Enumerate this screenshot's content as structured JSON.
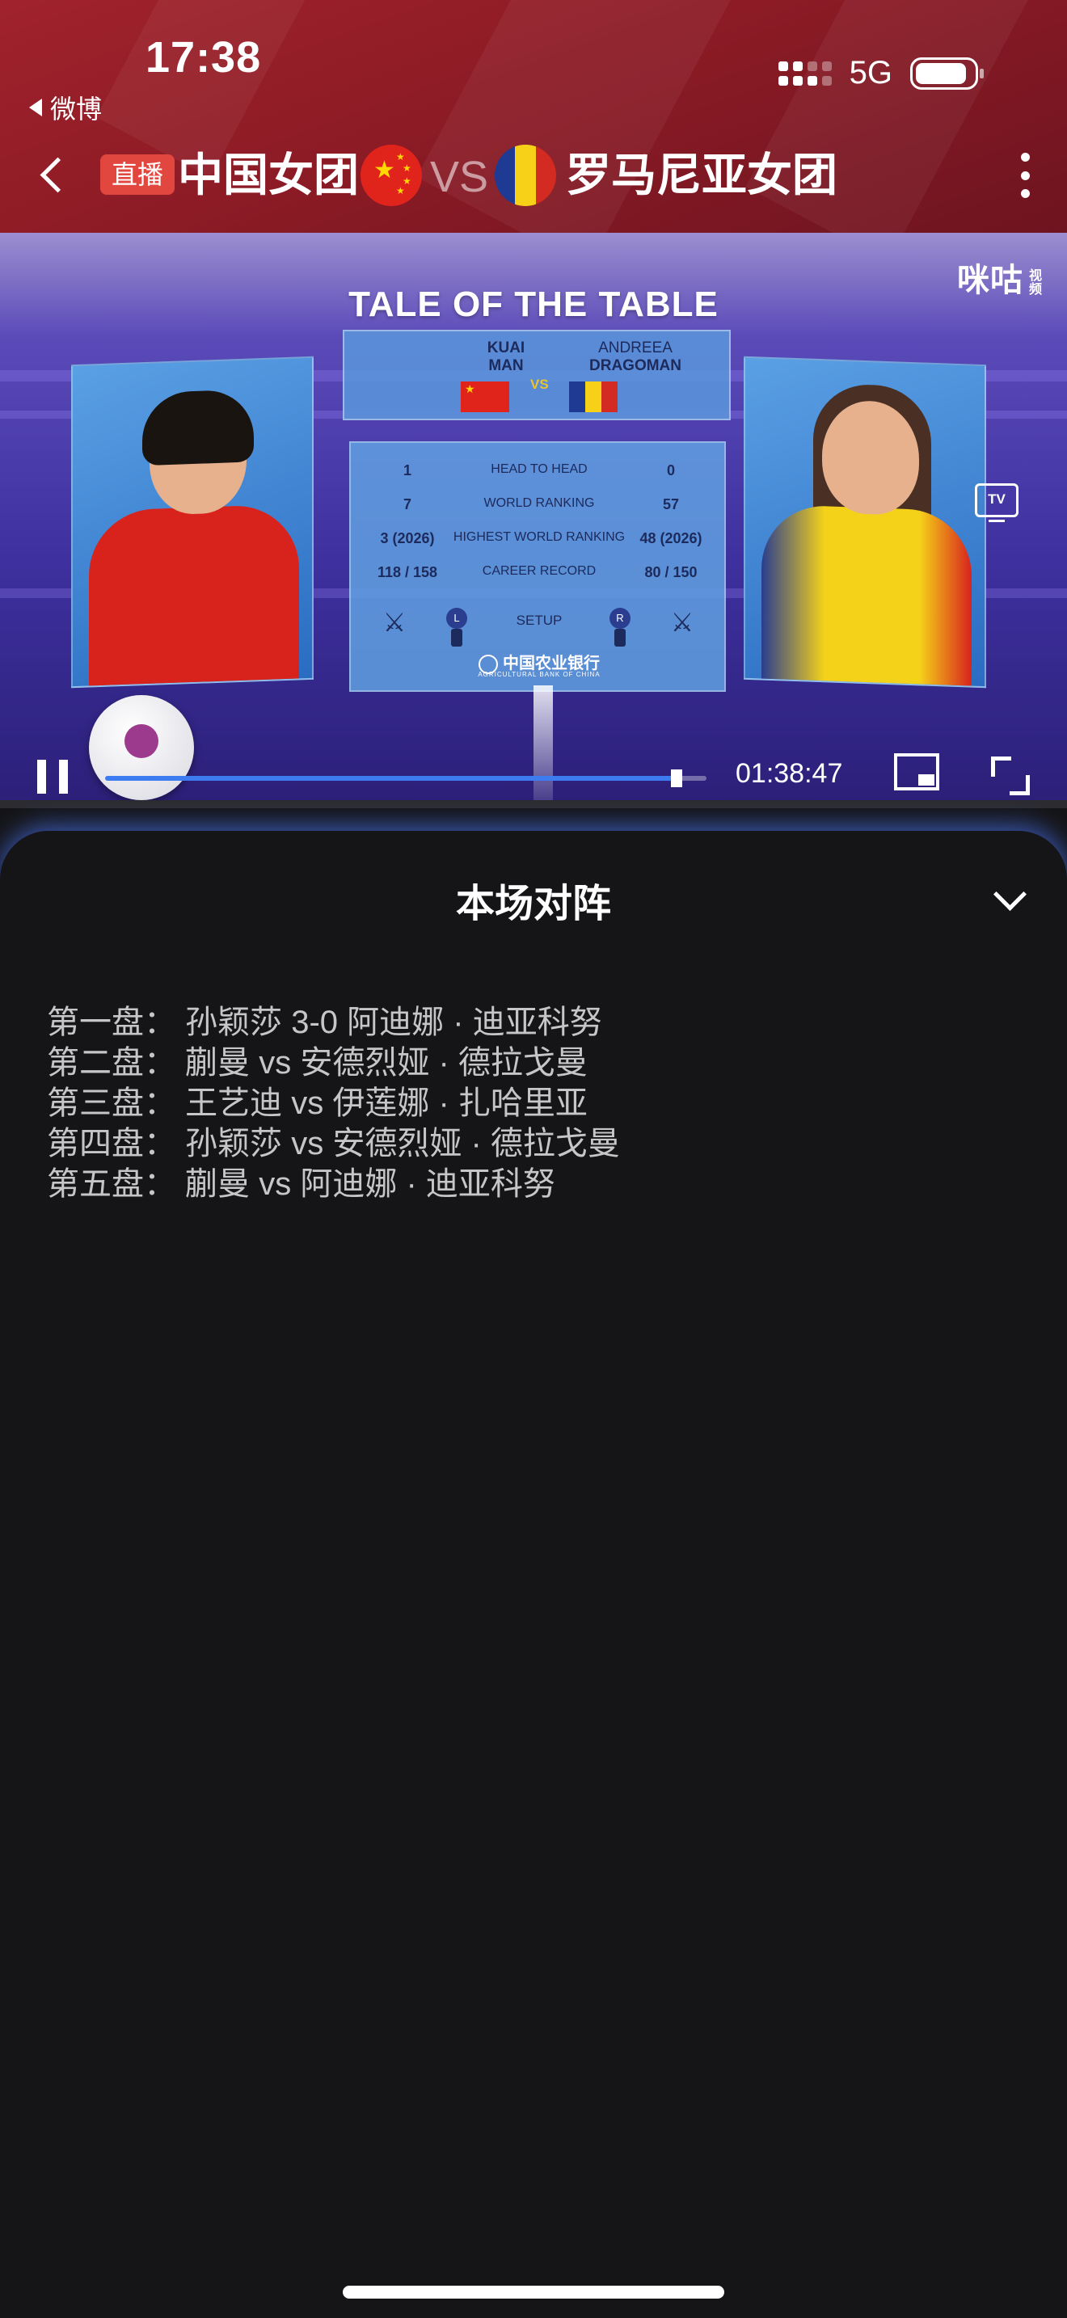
{
  "status_bar": {
    "time": "17:38",
    "back_app_label": "微博",
    "network": "5G"
  },
  "nav": {
    "live_badge": "直播",
    "team_a": "中国女团",
    "vs": "VS",
    "team_b": "罗马尼亚女团"
  },
  "video": {
    "watermark": "咪咕",
    "watermark_sub": "视频",
    "tv_label": "TV",
    "graphic": {
      "title": "TALE OF THE TABLE",
      "player_left_first": "KUAI",
      "player_left_last": "MAN",
      "player_right_first": "ANDREEA",
      "player_right_last": "DRAGOMAN",
      "vs": "VS",
      "stats": [
        {
          "left": "1",
          "label": "HEAD TO HEAD",
          "right": "0"
        },
        {
          "left": "7",
          "label": "WORLD RANKING",
          "right": "57"
        },
        {
          "left": "3 (2026)",
          "label": "HIGHEST WORLD RANKING",
          "right": "48 (2026)"
        },
        {
          "left": "118 / 158",
          "label": "CAREER RECORD",
          "right": "80 / 150"
        }
      ],
      "setup_label": "SETUP",
      "left_hand": "L",
      "right_hand": "R",
      "sponsor": "中国农业银行",
      "sponsor_sub": "AGRICULTURAL BANK OF CHINA"
    },
    "elapsed": "01:38:47",
    "progress_fraction": 0.95
  },
  "lineup": {
    "title": "本场对阵",
    "matches": [
      "第一盘：  孙颖莎 3-0 阿迪娜 · 迪亚科努",
      "第二盘：  蒯曼 vs 安德烈娅 · 德拉戈曼",
      "第三盘：  王艺迪 vs 伊莲娜 · 扎哈里亚",
      "第四盘：  孙颖莎 vs 安德烈娅 · 德拉戈曼",
      "第五盘：  蒯曼 vs 阿迪娜 · 迪亚科努"
    ]
  },
  "colors": {
    "header_red": "#8c1b25",
    "live_badge": "#e2473f",
    "progress_blue": "#3c7cf0",
    "sheet_glow": "#466ee6",
    "background": "#151517"
  }
}
